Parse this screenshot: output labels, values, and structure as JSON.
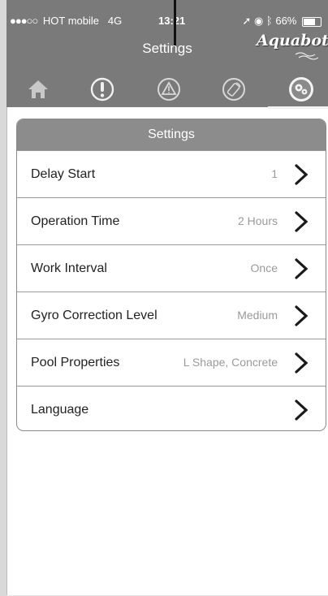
{
  "status_bar": {
    "signal": "●●●○○",
    "carrier": "HOT mobile",
    "network": "4G",
    "time": "13:21",
    "right_text": "66%",
    "icons": [
      "location-arrow-icon",
      "alarm-icon",
      "bluetooth-icon",
      "battery-icon"
    ]
  },
  "header": {
    "title": "Settings",
    "logo_text": "Aquabot"
  },
  "tabs": [
    {
      "name": "home",
      "icon": "home-icon"
    },
    {
      "name": "alert",
      "icon": "exclamation-circle-icon"
    },
    {
      "name": "warning",
      "icon": "warning-triangle-icon"
    },
    {
      "name": "remote",
      "icon": "remote-control-icon"
    },
    {
      "name": "settings",
      "icon": "gears-icon",
      "active": true
    }
  ],
  "panel": {
    "title": "Settings",
    "rows": [
      {
        "label": "Delay Start",
        "value": "1"
      },
      {
        "label": "Operation Time",
        "value": "2 Hours"
      },
      {
        "label": "Work Interval",
        "value": "Once"
      },
      {
        "label": "Gyro Correction Level",
        "value": "Medium"
      },
      {
        "label": "Pool Properties",
        "value": "L Shape, Concrete"
      },
      {
        "label": "Language",
        "value": ""
      }
    ]
  },
  "colors": {
    "header_bg": "#7a7a7a",
    "panel_header_bg": "#8c8c8c",
    "row_label": "#222222",
    "row_value": "#9a9a9a"
  }
}
